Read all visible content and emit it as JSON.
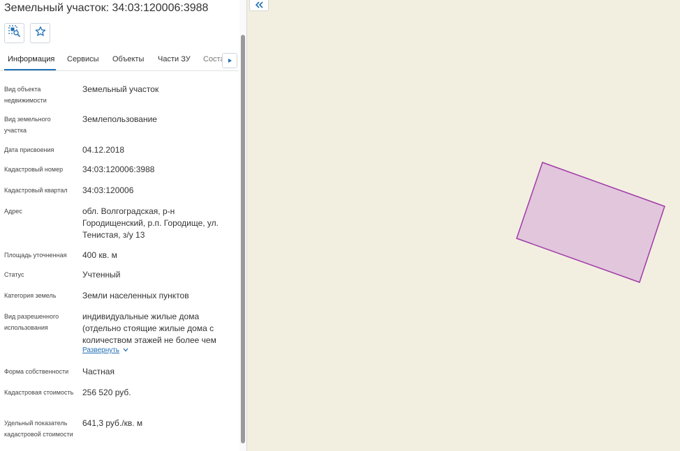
{
  "header": {
    "title": "Земельный участок: 34:03:120006:3988"
  },
  "toolbar": {
    "zoom_icon": "zoom-to-object-icon",
    "favorite_icon": "star-icon"
  },
  "tabs": [
    {
      "label": "Информация",
      "active": true
    },
    {
      "label": "Сервисы",
      "active": false
    },
    {
      "label": "Объекты",
      "active": false
    },
    {
      "label": "Части ЗУ",
      "active": false
    },
    {
      "label": "Соста",
      "active": false
    }
  ],
  "info": {
    "object_type": {
      "label": "Вид объекта недвижимости",
      "value": "Земельный участок"
    },
    "land_type": {
      "label": "Вид земельного участка",
      "value": "Землепользование"
    },
    "assign_date": {
      "label": "Дата присвоения",
      "value": "04.12.2018"
    },
    "cadastral_number": {
      "label": "Кадастровый номер",
      "value": "34:03:120006:3988"
    },
    "cadastral_block": {
      "label": "Кадастровый квартал",
      "value": "34:03:120006"
    },
    "address": {
      "label": "Адрес",
      "value": "обл. Волгоградская, р-н Городищенский, р.п. Городище, ул. Тенистая, з/у 13"
    },
    "area": {
      "label": "Площадь уточненная",
      "value": "400 кв. м"
    },
    "status": {
      "label": "Статус",
      "value": "Учтенный"
    },
    "land_category": {
      "label": "Категория земель",
      "value": "Земли населенных пунктов"
    },
    "permitted_use": {
      "label": "Вид разрешенного использования",
      "value": "индивидуальные жилые дома (отдельно стоящие жилые дома с количеством этажей не более чем",
      "expand_label": "Развернуть"
    },
    "ownership": {
      "label": "Форма собственности",
      "value": "Частная"
    },
    "cadastral_value": {
      "label": "Кадастровая стоимость",
      "value": "256 520 руб."
    },
    "specific_value": {
      "label": "Удельный показатель кадастровой стоимости",
      "value": "641,3 руб./кв. м"
    }
  },
  "colors": {
    "accent": "#1f6fb5",
    "map_background": "#f2efe0",
    "parcel_fill": "#e2c6dc",
    "parcel_stroke": "#a03aa8"
  }
}
